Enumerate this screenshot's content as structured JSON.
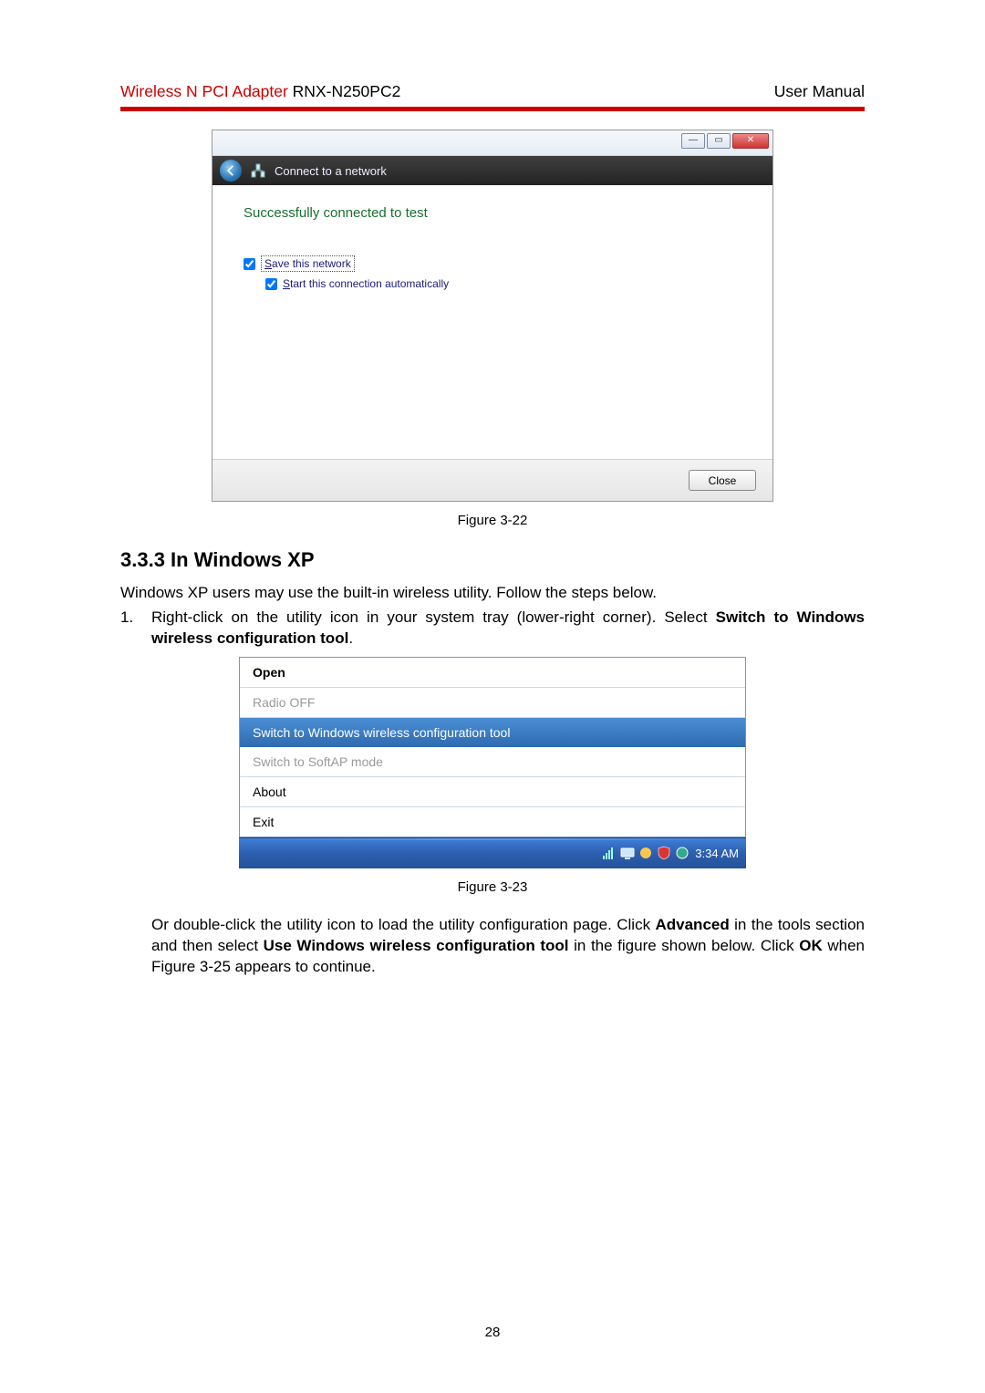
{
  "header": {
    "brand": "Wireless N PCI Adapter ",
    "model": "RNX-N250PC2",
    "right": "User Manual"
  },
  "fig22": {
    "toolbar_label": "Connect to a network",
    "success_text": "Successfully connected to test",
    "save_label": "ave this network",
    "save_prefix": "S",
    "start_label": "tart this connection automatically",
    "start_prefix": "S",
    "close_label": "Close",
    "caption": "Figure 3-22"
  },
  "section": {
    "heading": "3.3.3 In Windows XP",
    "intro": "Windows XP users may use the built-in wireless utility. Follow the steps below.",
    "step1_num": "1.",
    "step1_a": "Right-click on the utility icon in your system tray (lower-right corner). Select ",
    "step1_b1": "Switch to Windows wireless configuration tool",
    "step1_c": "."
  },
  "fig23": {
    "menu": {
      "open": "Open",
      "radio_off": "Radio OFF",
      "switch": "Switch to Windows wireless configuration tool",
      "softap": "Switch to SoftAP mode",
      "about": "About",
      "exit": "Exit"
    },
    "time": "3:34 AM",
    "caption": "Figure 3-23"
  },
  "para2": {
    "a": "Or double-click the utility icon to load the utility configuration page. Click ",
    "b1": "Advanced",
    "c": " in the tools section and then select ",
    "b2": "Use Windows wireless configuration tool",
    "d": " in the figure shown below. Click ",
    "b3": "OK",
    "e": " when Figure 3-25 appears to continue."
  },
  "page_number": "28"
}
